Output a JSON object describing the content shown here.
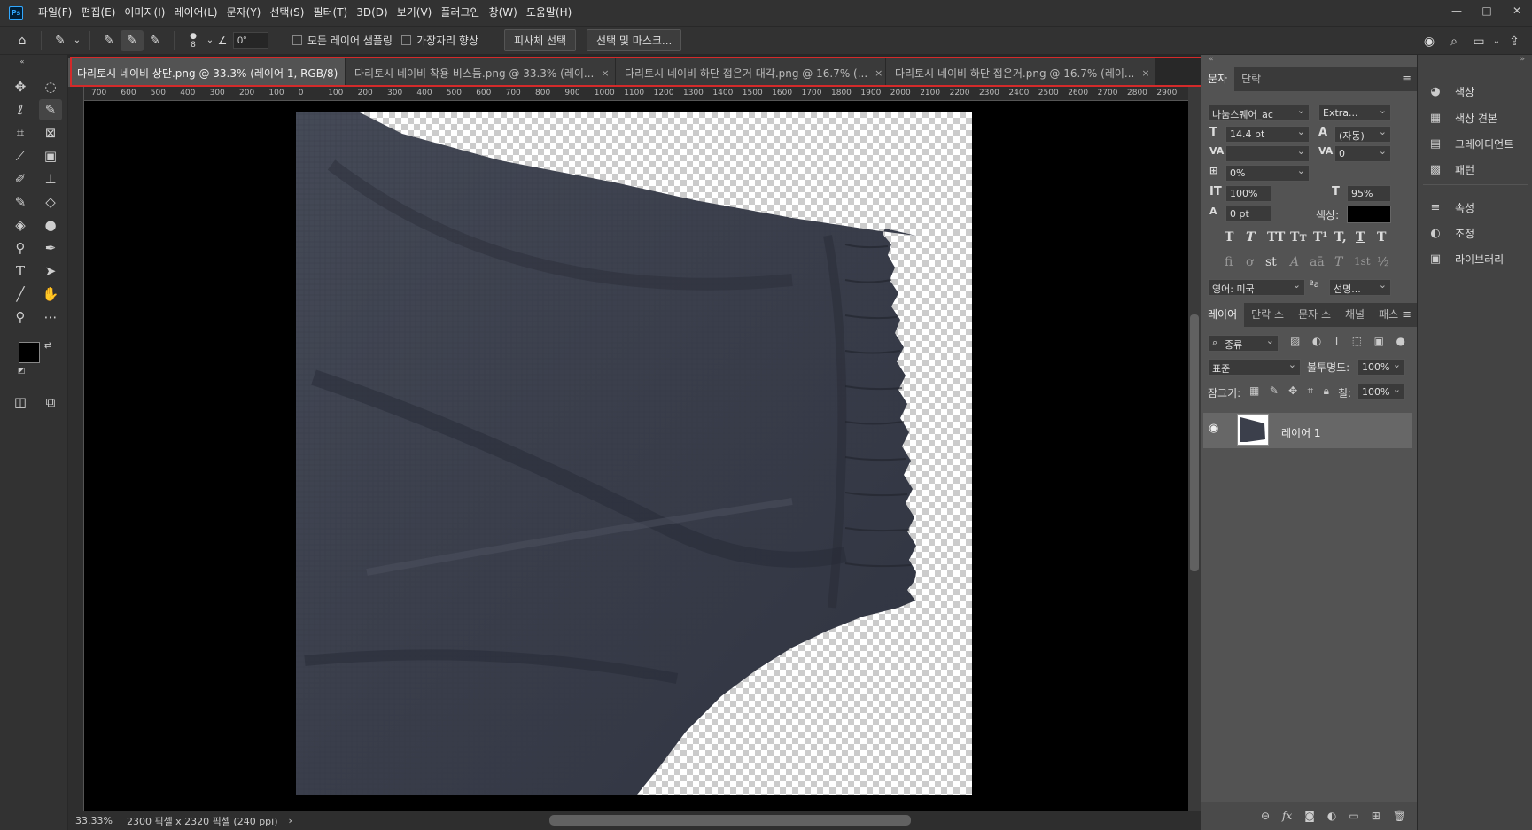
{
  "app": {
    "logo": "Ps"
  },
  "menu": [
    "파일(F)",
    "편집(E)",
    "이미지(I)",
    "레이어(L)",
    "문자(Y)",
    "선택(S)",
    "필터(T)",
    "3D(D)",
    "보기(V)",
    "플러그인",
    "창(W)",
    "도움말(H)"
  ],
  "window_controls": {
    "minimize": "—",
    "maximize": "□",
    "close": "✕"
  },
  "options": {
    "brush_size": "8",
    "angle": "0°",
    "sample_all_layers": "모든 레이어 샘플링",
    "enhance_edge": "가장자리 향상",
    "select_subject": "피사체 선택",
    "select_and_mask": "선택 및 마스크..."
  },
  "tabs": [
    {
      "label": "다리토시 네이비 상단.png @ 33.3% (레이어 1, RGB/8)",
      "active": true
    },
    {
      "label": "다리토시 네이비 착용 비스듬.png @ 33.3% (레이...",
      "active": false
    },
    {
      "label": "다리토시 네이비 하단 접은거 대각.png @ 16.7% (...",
      "active": false
    },
    {
      "label": "다리토시 네이비 하단 접은거.png @ 16.7% (레이...",
      "active": false
    }
  ],
  "tab_close": "×",
  "ruler_marks": [
    "700",
    "600",
    "500",
    "400",
    "300",
    "200",
    "100",
    "0",
    "100",
    "200",
    "300",
    "400",
    "500",
    "600",
    "700",
    "800",
    "900",
    "1000",
    "1100",
    "1200",
    "1300",
    "1400",
    "1500",
    "1600",
    "1700",
    "1800",
    "1900",
    "2000",
    "2100",
    "2200",
    "2300",
    "2400",
    "2500",
    "2600",
    "2700",
    "2800",
    "2900"
  ],
  "status": {
    "zoom": "33.33%",
    "doc_info": "2300 픽셀 x 2320 픽셀 (240 ppi)",
    "arrow": "›"
  },
  "character_panel": {
    "tabs": [
      "문자",
      "단락"
    ],
    "font_family": "나눔스퀘어_ac",
    "font_style": "Extra...",
    "size": "14.4 pt",
    "leading": "(자동)",
    "kerning": "",
    "tracking": "0",
    "tsume": "0%",
    "vscale": "100%",
    "hscale": "95%",
    "baseline": "0 pt",
    "color_label": "색상:",
    "language": "영어: 미국",
    "antialias": "선명...",
    "aa_icon": "ªa",
    "style_buttons": [
      "T",
      "T",
      "TT",
      "Tт",
      "T¹",
      "T,",
      "T",
      "T"
    ],
    "opentype_buttons": [
      "fi",
      "ơ",
      "st",
      "A",
      "aā",
      "T",
      "1st",
      "½"
    ]
  },
  "layers_panel": {
    "tabs": [
      "레이어",
      "단락 스",
      "문자 스",
      "채널",
      "패스"
    ],
    "filter_label": "종류",
    "blend_mode": "표준",
    "opacity_label": "불투명도:",
    "opacity": "100%",
    "lock_label": "잠그기:",
    "fill_label": "칠:",
    "fill": "100%",
    "layers": [
      {
        "name": "레이어 1",
        "visible": true
      }
    ],
    "footer_icons": [
      "link-icon",
      "fx",
      "mask-icon",
      "adjustment-icon",
      "group-icon",
      "new-layer-icon",
      "trash-icon"
    ]
  },
  "right_panel": {
    "items": [
      "색상",
      "색상 견본",
      "그레이디언트",
      "패턴",
      "속성",
      "조정",
      "라이브러리"
    ]
  },
  "colors": {
    "accent": "#31a8ff",
    "highlight_border": "#d42a2a",
    "fabric": "#3b3f4b"
  }
}
